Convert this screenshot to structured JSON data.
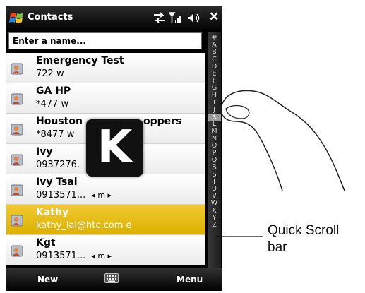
{
  "titlebar": {
    "title": "Contacts"
  },
  "search": {
    "placeholder": "Enter a name..."
  },
  "contacts": [
    {
      "name": "Emergency Test",
      "detail": "722  w",
      "nav": ""
    },
    {
      "name": "GA HP",
      "detail": "*477  w",
      "nav": ""
    },
    {
      "name": "Houston",
      "name_tail": "oppers",
      "detail": "*8477  w",
      "nav": ""
    },
    {
      "name": "Ivy",
      "detail": "0937276.",
      "nav": ""
    },
    {
      "name": "Ivy Tsai",
      "detail": "0913571...",
      "nav": "◂ m ▸"
    },
    {
      "name": "Kathy",
      "detail": "kathy_lai@htc.com  e",
      "nav": "",
      "selected": true
    },
    {
      "name": "Kgt",
      "detail": "0913571...",
      "nav": "◂ m ▸"
    }
  ],
  "scrollbar": {
    "letters": [
      "#",
      "A",
      "B",
      "C",
      "D",
      "E",
      "F",
      "G",
      "H",
      "I",
      "J",
      "K",
      "L",
      "M",
      "N",
      "O",
      "P",
      "Q",
      "R",
      "S",
      "T",
      "U",
      "V",
      "W",
      "X",
      "Y",
      "Z"
    ],
    "highlighted": "K"
  },
  "overlay": {
    "letter": "K"
  },
  "softkeys": {
    "left": "New",
    "right": "Menu"
  },
  "callout": {
    "line1": "Quick Scroll",
    "line2": "bar"
  },
  "colors": {
    "selection": "#e8bc10",
    "titlebar": "#111111",
    "accent_text": "#ffffff"
  },
  "icons": [
    "windows-start-icon",
    "sync-arrows-icon",
    "signal-icon",
    "speaker-icon",
    "close-icon",
    "contact-card-icon",
    "keyboard-icon",
    "finger-illustration"
  ]
}
